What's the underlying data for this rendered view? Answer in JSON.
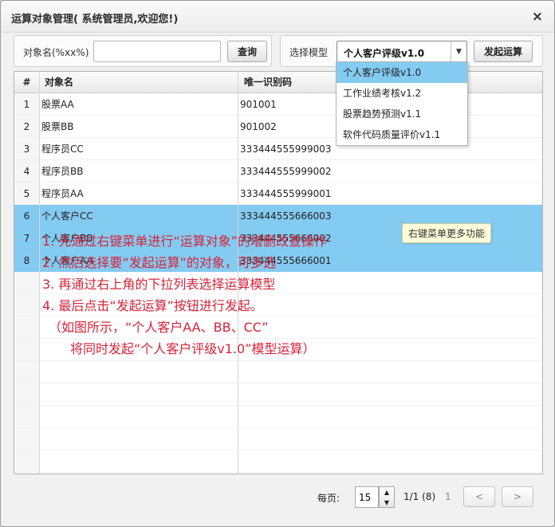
{
  "window": {
    "title": "运算对象管理( 系统管理员,欢迎您!)",
    "close_glyph": "×"
  },
  "search": {
    "label": "对象名(%xx%)",
    "value": "",
    "placeholder": "",
    "query_button": "查询"
  },
  "model": {
    "label": "选择模型",
    "selected": "个人客户评级v1.0",
    "arrow_glyph": "▼",
    "submit_button": "发起运算",
    "options": [
      "个人客户评级v1.0",
      "工作业绩考核v1.2",
      "股票趋势预测v1.1",
      "软件代码质量评价v1.1"
    ]
  },
  "table": {
    "columns": {
      "num": "#",
      "name": "对象名",
      "id": "唯一识别码"
    },
    "rows": [
      {
        "num": "1",
        "name": "股票AA",
        "id": "901001",
        "selected": false
      },
      {
        "num": "2",
        "name": "股票BB",
        "id": "901002",
        "selected": false
      },
      {
        "num": "3",
        "name": "程序员CC",
        "id": "333444555999003",
        "selected": false
      },
      {
        "num": "4",
        "name": "程序员BB",
        "id": "333444555999002",
        "selected": false
      },
      {
        "num": "5",
        "name": "程序员AA",
        "id": "333444555999001",
        "selected": false
      },
      {
        "num": "6",
        "name": "个人客户CC",
        "id": "333444555666003",
        "selected": true
      },
      {
        "num": "7",
        "name": "个人客户BB",
        "id": "333444555666002",
        "selected": true
      },
      {
        "num": "8",
        "name": "个人客户AA",
        "id": "333444555666001",
        "selected": true
      }
    ]
  },
  "tooltip": "右键菜单更多功能",
  "instructions": [
    "1. 先通过右键菜单进行“运算对象”的增删改查操作",
    "2. 然后选择要“发起运算”的对象，可多选",
    "3. 再通过右上角的下拉列表选择运算模型",
    "4. 最后点击“发起运算”按钮进行发起。",
    "（如图所示，“个人客户AA、BB、CC”",
    "将同时发起“个人客户评级v1.0”模型运算）"
  ],
  "pager": {
    "per_page_label": "每页:",
    "per_page_value": "15",
    "page_info": "1/1 (8)",
    "current_page": "1",
    "prev_label": "<",
    "next_label": ">",
    "up_glyph": "▲",
    "down_glyph": "▼"
  },
  "colors": {
    "selection": "#84cbf1",
    "instruction_text": "#d6233a",
    "tooltip_bg": "#fffcd9"
  }
}
